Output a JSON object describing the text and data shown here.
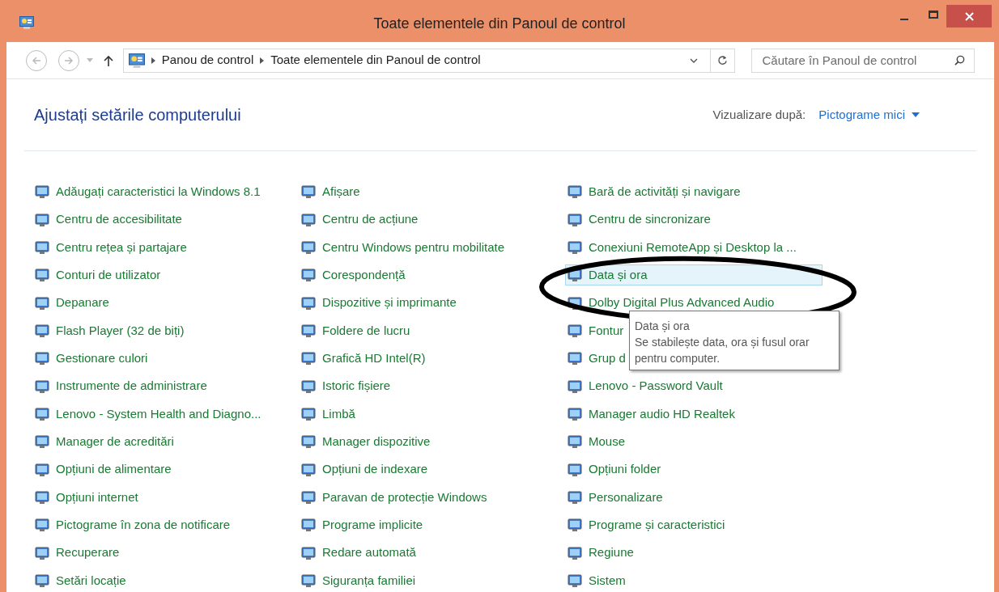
{
  "window": {
    "title": "Toate elementele din Panoul de control"
  },
  "address_bar": {
    "breadcrumbs": [
      "Panou de control",
      "Toate elementele din Panoul de control"
    ]
  },
  "search": {
    "placeholder": "Căutare în Panoul de control"
  },
  "header": {
    "title": "Ajustați setările computerului",
    "view_label": "Vizualizare după:",
    "view_value": "Pictograme mici"
  },
  "columns": [
    {
      "items": [
        {
          "label": "Adăugați caracteristici la Windows 8.1",
          "selected": false
        },
        {
          "label": "Centru de accesibilitate",
          "selected": false
        },
        {
          "label": "Centru rețea și partajare",
          "selected": false
        },
        {
          "label": "Conturi de utilizator",
          "selected": false
        },
        {
          "label": "Depanare",
          "selected": false
        },
        {
          "label": "Flash Player (32 de biți)",
          "selected": false
        },
        {
          "label": "Gestionare culori",
          "selected": false
        },
        {
          "label": "Instrumente de administrare",
          "selected": false
        },
        {
          "label": "Lenovo - System Health and Diagno...",
          "selected": false
        },
        {
          "label": "Manager de acreditări",
          "selected": false
        },
        {
          "label": "Opțiuni de alimentare",
          "selected": false
        },
        {
          "label": "Opțiuni internet",
          "selected": false
        },
        {
          "label": "Pictograme în zona de notificare",
          "selected": false
        },
        {
          "label": "Recuperare",
          "selected": false
        },
        {
          "label": "Setări locație",
          "selected": false
        }
      ]
    },
    {
      "items": [
        {
          "label": "Afișare",
          "selected": false
        },
        {
          "label": "Centru de acțiune",
          "selected": false
        },
        {
          "label": "Centru Windows pentru mobilitate",
          "selected": false
        },
        {
          "label": "Corespondență",
          "selected": false
        },
        {
          "label": "Dispozitive și imprimante",
          "selected": false
        },
        {
          "label": "Foldere de lucru",
          "selected": false
        },
        {
          "label": "Grafică HD Intel(R)",
          "selected": false
        },
        {
          "label": "Istoric fișiere",
          "selected": false
        },
        {
          "label": "Limbă",
          "selected": false
        },
        {
          "label": "Manager dispozitive",
          "selected": false
        },
        {
          "label": "Opțiuni de indexare",
          "selected": false
        },
        {
          "label": "Paravan de protecție Windows",
          "selected": false
        },
        {
          "label": "Programe implicite",
          "selected": false
        },
        {
          "label": "Redare automată",
          "selected": false
        },
        {
          "label": "Siguranța familiei",
          "selected": false
        }
      ]
    },
    {
      "items": [
        {
          "label": "Bară de activități și navigare",
          "selected": false
        },
        {
          "label": "Centru de sincronizare",
          "selected": false
        },
        {
          "label": "Conexiuni RemoteApp și Desktop la ...",
          "selected": false
        },
        {
          "label": "Data și ora",
          "selected": true
        },
        {
          "label": "Dolby Digital Plus Advanced Audio",
          "selected": false
        },
        {
          "label": "Fontur",
          "selected": false
        },
        {
          "label": "Grup d",
          "selected": false
        },
        {
          "label": "Lenovo - Password Vault",
          "selected": false
        },
        {
          "label": "Manager audio HD Realtek",
          "selected": false
        },
        {
          "label": "Mouse",
          "selected": false
        },
        {
          "label": "Opțiuni folder",
          "selected": false
        },
        {
          "label": "Personalizare",
          "selected": false
        },
        {
          "label": "Programe și caracteristici",
          "selected": false
        },
        {
          "label": "Regiune",
          "selected": false
        },
        {
          "label": "Sistem",
          "selected": false
        }
      ]
    }
  ],
  "tooltip": {
    "title": "Data și ora",
    "text": "Se stabilește data, ora și fusul orar pentru computer."
  }
}
